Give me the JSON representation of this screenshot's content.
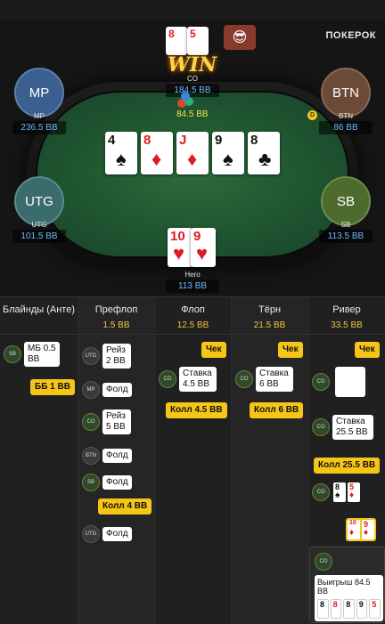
{
  "app": {
    "logo": "ПОКЕРОК"
  },
  "table": {
    "win_label": "WIN",
    "pot": "84.5 BB",
    "winner_cards": [
      {
        "rank": "8",
        "suit": "♦",
        "color": "red"
      },
      {
        "rank": "5",
        "suit": "♥",
        "color": "red"
      }
    ],
    "board": [
      {
        "rank": "4",
        "suit": "♠",
        "color": "black"
      },
      {
        "rank": "8",
        "suit": "♦",
        "color": "red"
      },
      {
        "rank": "J",
        "suit": "♦",
        "color": "red"
      },
      {
        "rank": "9",
        "suit": "♠",
        "color": "black"
      },
      {
        "rank": "8",
        "suit": "♣",
        "color": "black"
      }
    ],
    "hero_cards": [
      {
        "rank": "10",
        "suit": "♥",
        "color": "red"
      },
      {
        "rank": "9",
        "suit": "♥",
        "color": "red"
      }
    ],
    "seats": {
      "co": {
        "name": "CO",
        "stack": "184.5 BB"
      },
      "mp": {
        "avatar": "MP",
        "name": "MP",
        "stack": "236.5 BB"
      },
      "btn": {
        "avatar": "BTN",
        "name": "BTN",
        "stack": "86 BB"
      },
      "utg": {
        "avatar": "UTG",
        "name": "UTG",
        "stack": "101.5 BB"
      },
      "sb": {
        "avatar": "SB",
        "name": "SB",
        "stack": "113.5 BB"
      },
      "hero": {
        "name": "Hero",
        "stack": "113 BB"
      }
    },
    "dealer": "D"
  },
  "streets": [
    {
      "title": "Блайнды (Анте)",
      "pot": ""
    },
    {
      "title": "Префлоп",
      "pot": "1.5 BB"
    },
    {
      "title": "Флоп",
      "pot": "12.5 BB"
    },
    {
      "title": "Тёрн",
      "pot": "21.5 BB"
    },
    {
      "title": "Ривер",
      "pot": "33.5 BB"
    }
  ],
  "actions": {
    "blinds": {
      "sb_pos": "SB",
      "sb_text": "МБ 0.5 BB",
      "bb_text": "ББ 1 BB"
    },
    "preflop": [
      {
        "pos": "UTG",
        "text": "Рейз 2 BB"
      },
      {
        "pos": "MP",
        "text": "Фолд"
      },
      {
        "pos": "CO",
        "text": "Рейз 5 BB"
      },
      {
        "pos": "BTN",
        "text": "Фолд"
      },
      {
        "pos": "SB",
        "text": "Фолд"
      },
      {
        "call": "Колл 4 BB"
      },
      {
        "pos": "UTG",
        "text": "Фолд"
      }
    ],
    "flop": {
      "check": "Чек",
      "pos": "CO",
      "bet": "Ставка 4.5 BB",
      "call": "Колл 4.5 BB"
    },
    "turn": {
      "check": "Чек",
      "pos": "CO",
      "bet": "Ставка 6 BB",
      "call": "Колл 6 BB"
    },
    "river": {
      "check": "Чек",
      "pos": "CO",
      "bet": "Ставка 25.5 BB",
      "call": "Колл 25.5 BB",
      "show_pos": "CO",
      "show_cards": [
        {
          "rank": "8",
          "suit": "♠",
          "color": "black"
        },
        {
          "rank": "5",
          "suit": "♦",
          "color": "red"
        }
      ],
      "hero_cards": [
        {
          "rank": "10",
          "suit": "♦",
          "color": "red"
        },
        {
          "rank": "9",
          "suit": "♦",
          "color": "red"
        }
      ],
      "win_pos": "CO",
      "win_text": "Выигрыш 84.5 BB",
      "win_cards": [
        "8",
        "8",
        "8",
        "9",
        "5"
      ]
    }
  }
}
